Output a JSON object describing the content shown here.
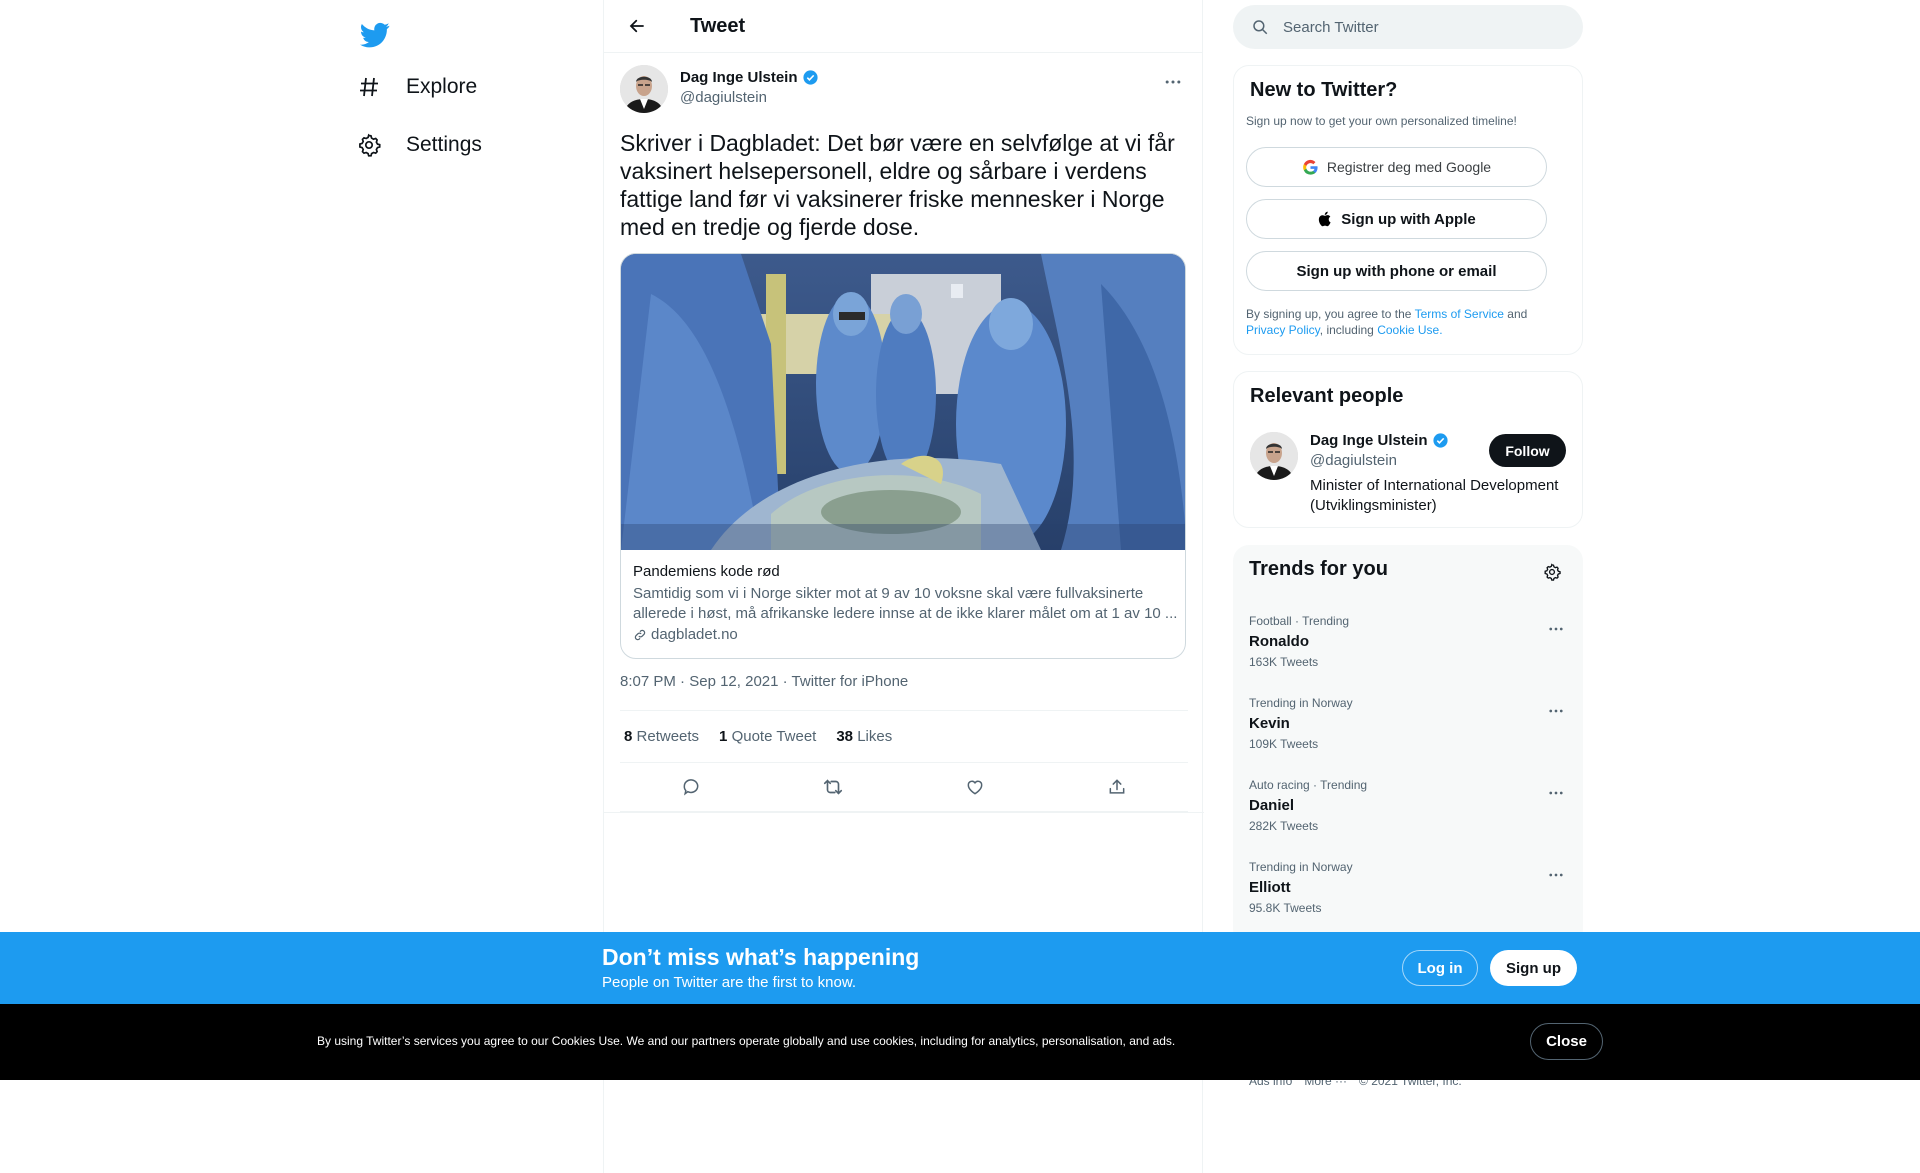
{
  "nav": {
    "items": [
      {
        "label": "Explore",
        "icon": "hashtag-icon"
      },
      {
        "label": "Settings",
        "icon": "gear-icon"
      }
    ]
  },
  "header": {
    "title": "Tweet"
  },
  "tweet": {
    "author_name": "Dag Inge Ulstein",
    "author_handle": "@dagiulstein",
    "text": "Skriver i Dagbladet: Det bør være en selvfølge at vi får vaksinert helsepersonell, eldre og sårbare i verdens fattige land før vi vaksinerer friske mennesker i Norge med en tredje og fjerde dose.",
    "card": {
      "title": "Pandemiens kode rød",
      "description": "Samtidig som vi i Norge sikter mot at 9 av 10 voksne skal være fullvaksinerte allerede i høst, må afrikanske ledere innse at de ikke klarer målet om at 1 av 10 ...",
      "domain": "dagbladet.no"
    },
    "time": "8:07 PM",
    "date": "Sep 12, 2021",
    "source": "Twitter for iPhone",
    "retweets": "8",
    "retweets_label": "Retweets",
    "quotes": "1",
    "quotes_label": "Quote Tweet",
    "likes": "38",
    "likes_label": "Likes"
  },
  "search": {
    "placeholder": "Search Twitter"
  },
  "signup_panel": {
    "title": "New to Twitter?",
    "subtitle": "Sign up now to get your own personalized timeline!",
    "google_label": "Registrer deg med Google",
    "apple_label": "Sign up with Apple",
    "phone_label": "Sign up with phone or email",
    "terms_prefix": "By signing up, you agree to the",
    "terms_link": "Terms of Service",
    "terms_and": "and",
    "privacy_link": "Privacy Policy",
    "including": ", including",
    "cookie_link": "Cookie Use."
  },
  "relevant": {
    "title": "Relevant people",
    "name": "Dag Inge Ulstein",
    "handle": "@dagiulstein",
    "bio": "Minister of International Development (Utviklingsminister)",
    "follow_label": "Follow"
  },
  "trends": {
    "title": "Trends for you",
    "items": [
      {
        "context": "Football · Trending",
        "name": "Ronaldo",
        "count": "163K Tweets"
      },
      {
        "context": "Trending in Norway",
        "name": "Kevin",
        "count": "109K Tweets"
      },
      {
        "context": "Auto racing · Trending",
        "name": "Daniel",
        "count": "282K Tweets"
      },
      {
        "context": "Trending in Norway",
        "name": "Elliott",
        "count": "95.8K Tweets"
      }
    ]
  },
  "footer": {
    "ads_info": "Ads info",
    "more": "More ···",
    "copyright": "© 2021 Twitter, Inc."
  },
  "banner": {
    "heading": "Don’t miss what’s happening",
    "sub": "People on Twitter are the first to know.",
    "login_label": "Log in",
    "signup_label": "Sign up"
  },
  "cookie": {
    "text": "By using Twitter’s services you agree to our Cookies Use. We and our partners operate globally and use cookies, including for analytics, personalisation, and ads.",
    "close_label": "Close"
  },
  "colors": {
    "brand": "#1d9bf0",
    "text": "#0f1419",
    "secondary": "#536471"
  }
}
